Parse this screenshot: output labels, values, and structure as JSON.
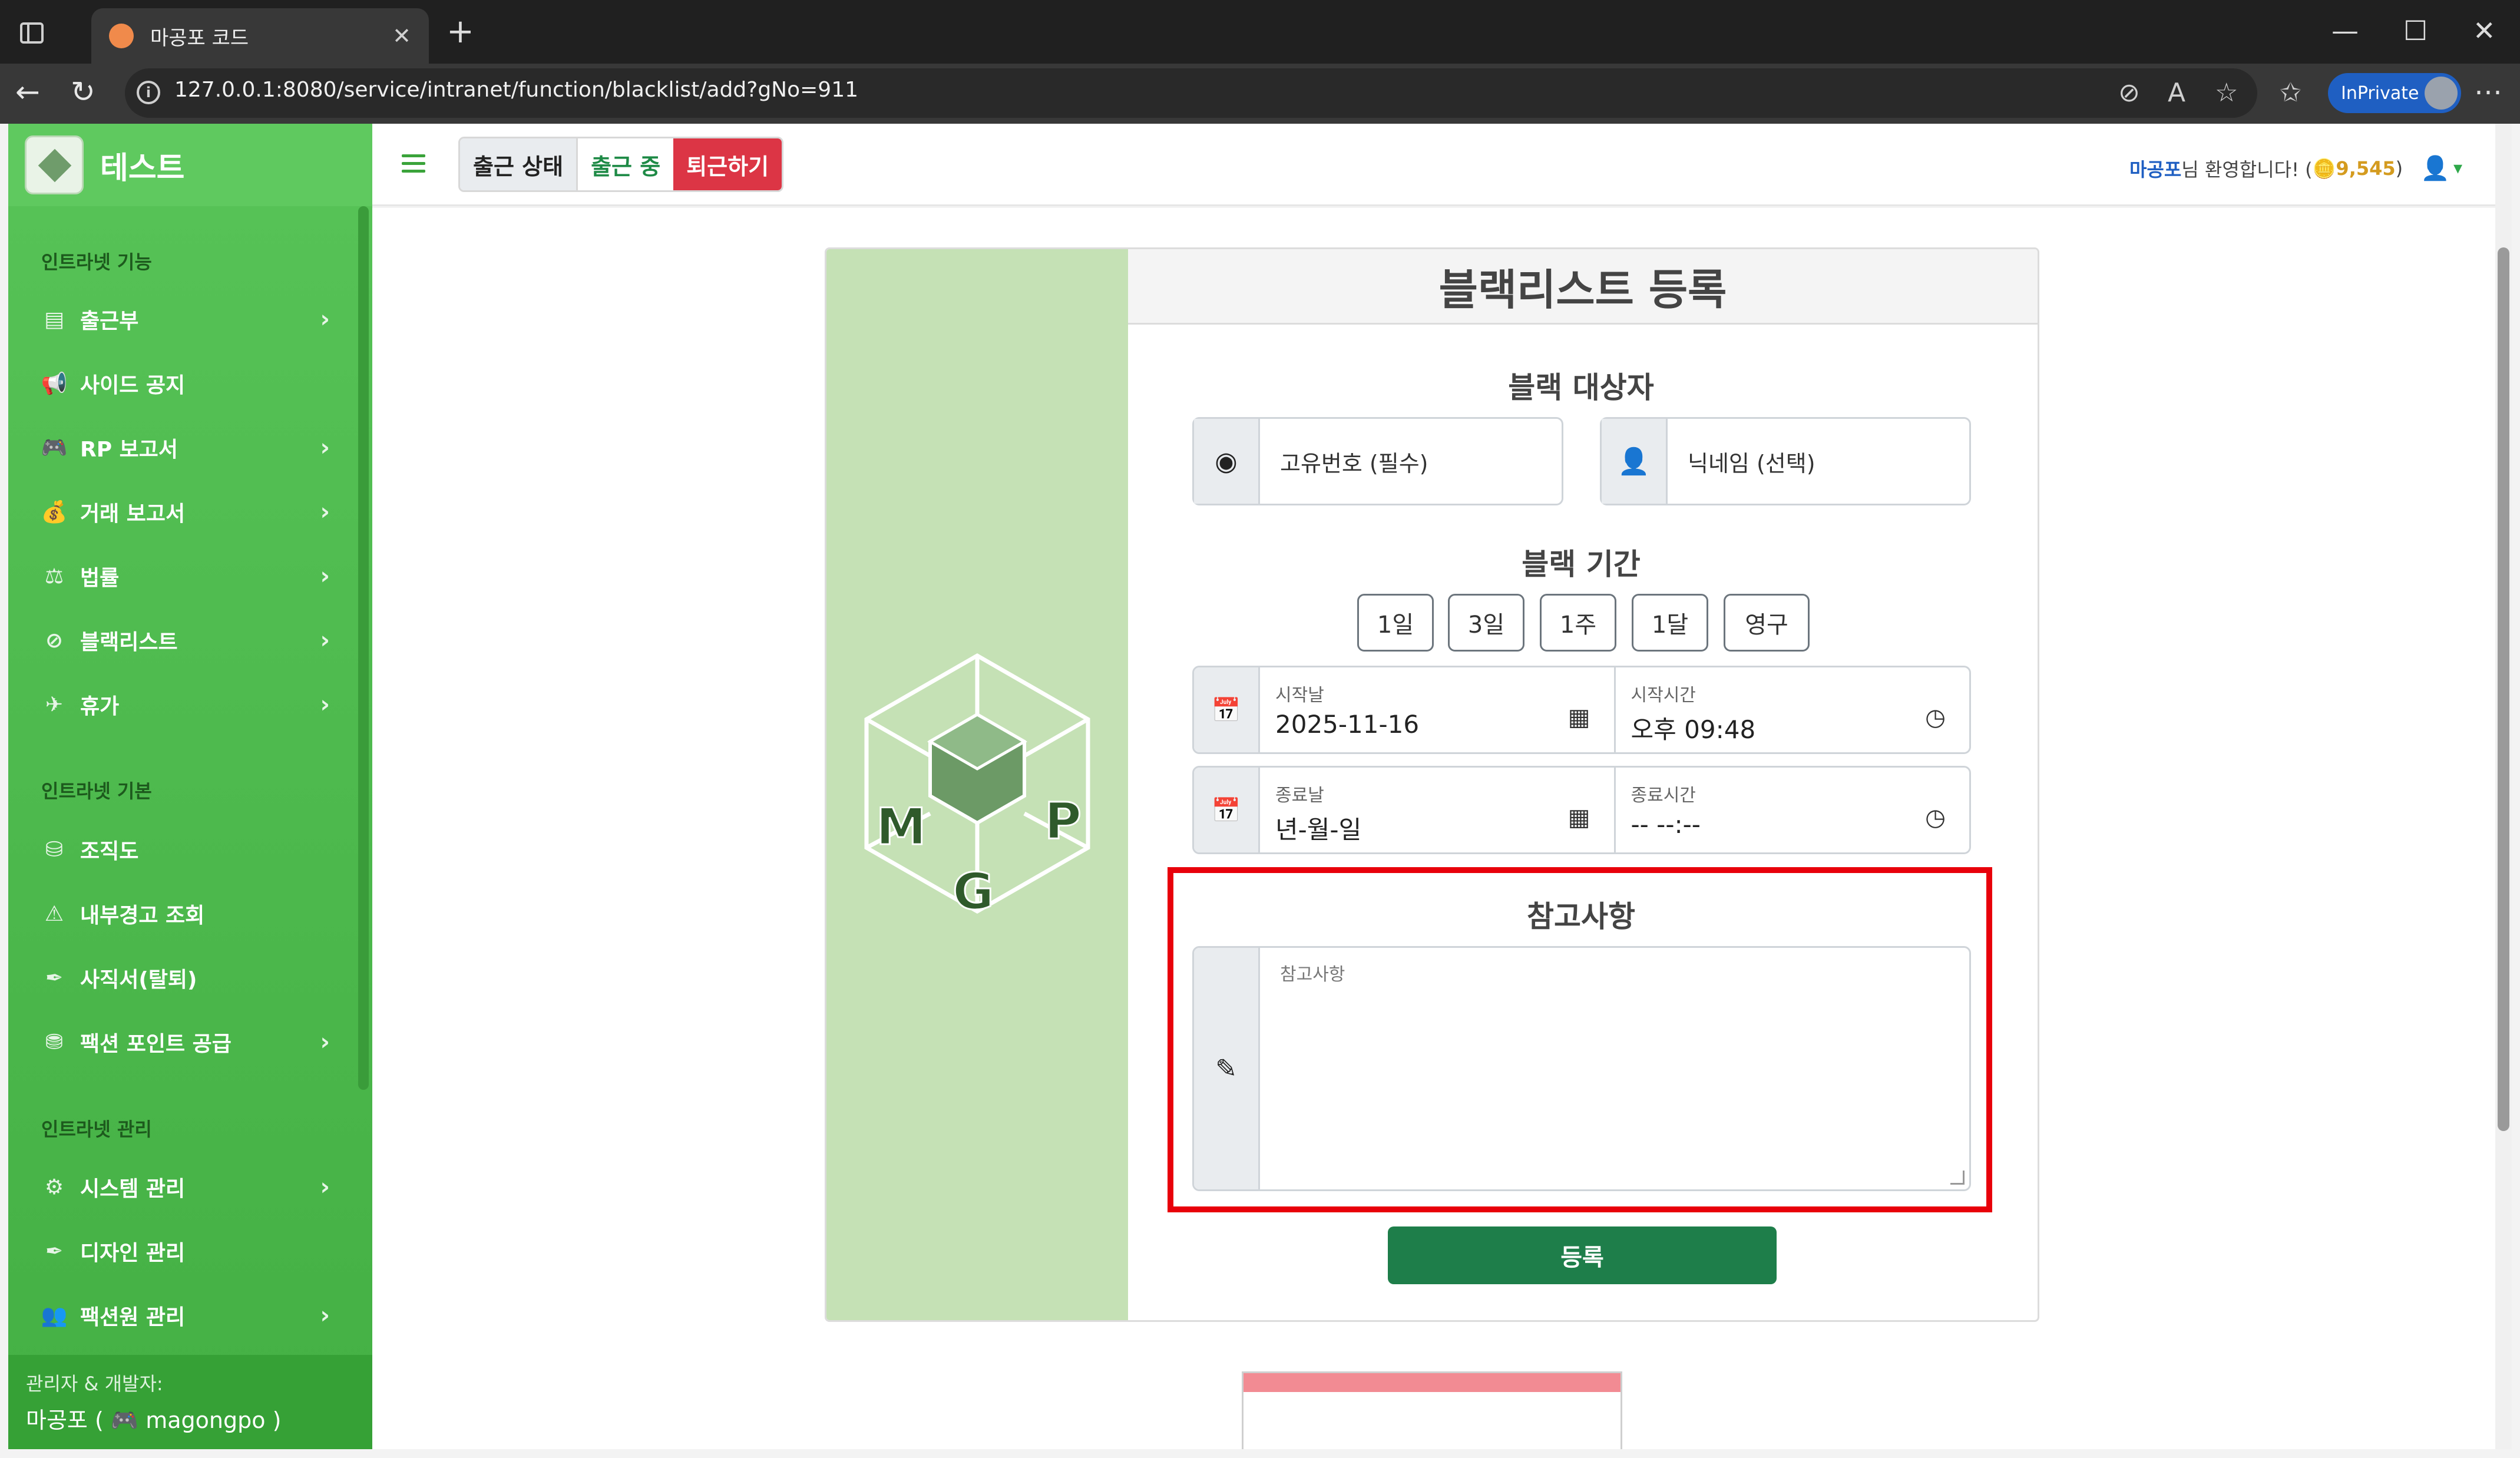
{
  "browser": {
    "tab_title": "마공포 코드",
    "tab_close": "✕",
    "new_tab": "+",
    "url": "127.0.0.1:8080/service/intranet/function/blacklist/add?gNo=911",
    "inprivate_label": "InPrivate",
    "window_controls": [
      "—",
      "☐",
      "✕"
    ]
  },
  "sidebar": {
    "brand": "테스트",
    "sections": [
      {
        "title": "인트라넷 기능",
        "items": [
          {
            "label": "출근부",
            "icon": "book-icon",
            "chevron": true
          },
          {
            "label": "사이드 공지",
            "icon": "megaphone-icon",
            "chevron": false
          },
          {
            "label": "RP 보고서",
            "icon": "gamepad-icon",
            "chevron": true
          },
          {
            "label": "거래 보고서",
            "icon": "money-bag-icon",
            "chevron": true
          },
          {
            "label": "법률",
            "icon": "scale-icon",
            "chevron": true
          },
          {
            "label": "블랙리스트",
            "icon": "ban-icon",
            "chevron": true
          },
          {
            "label": "휴가",
            "icon": "plane-icon",
            "chevron": true
          }
        ]
      },
      {
        "title": "인트라넷 기본",
        "items": [
          {
            "label": "조직도",
            "icon": "org-chart-icon",
            "chevron": false
          },
          {
            "label": "내부경고 조회",
            "icon": "warning-icon",
            "chevron": false
          },
          {
            "label": "사직서(탈퇴)",
            "icon": "feather-icon",
            "chevron": false
          },
          {
            "label": "팩션 포인트 공급",
            "icon": "coins-icon",
            "chevron": true
          }
        ]
      },
      {
        "title": "인트라넷 관리",
        "items": [
          {
            "label": "시스템 관리",
            "icon": "gear-icon",
            "chevron": true
          },
          {
            "label": "디자인 관리",
            "icon": "feather-icon",
            "chevron": false
          },
          {
            "label": "팩션원 관리",
            "icon": "user-gear-icon",
            "chevron": true
          }
        ]
      }
    ],
    "footer": {
      "line1": "관리자 & 개발자:",
      "line2": "마공포 ( 🎮 magongpo )"
    }
  },
  "header": {
    "status_label": "출근 상태",
    "status_value": "출근 중",
    "checkout_button": "퇴근하기",
    "welcome_name": "마공포",
    "welcome_text": "님 환영합니다! (",
    "points": "🪙9,545",
    "welcome_close": ")",
    "user_caret": "▾"
  },
  "form": {
    "title": "블랙리스트 등록",
    "target_title": "블랙 대상자",
    "id_placeholder": "고유번호 (필수)",
    "nickname_placeholder": "닉네임 (선택)",
    "period_title": "블랙 기간",
    "quick_buttons": [
      "1일",
      "3일",
      "1주",
      "1달",
      "영구"
    ],
    "start_date_label": "시작날",
    "start_date_value": "2025-11-16",
    "start_time_label": "시작시간",
    "start_time_value": "오후 09:48",
    "end_date_label": "종료날",
    "end_date_value": "년-월-일",
    "end_time_label": "종료시간",
    "end_time_value": "-- --:--",
    "note_title": "참고사항",
    "note_placeholder": "참고사항",
    "submit": "등록",
    "logo_letters": [
      "M",
      "G",
      "P"
    ]
  },
  "colors": {
    "sidebar_green": "#4cb84c",
    "danger": "#dc3545",
    "success": "#1e7e4a",
    "highlight": "#e8000b",
    "panel_green": "#c5e1b5"
  }
}
